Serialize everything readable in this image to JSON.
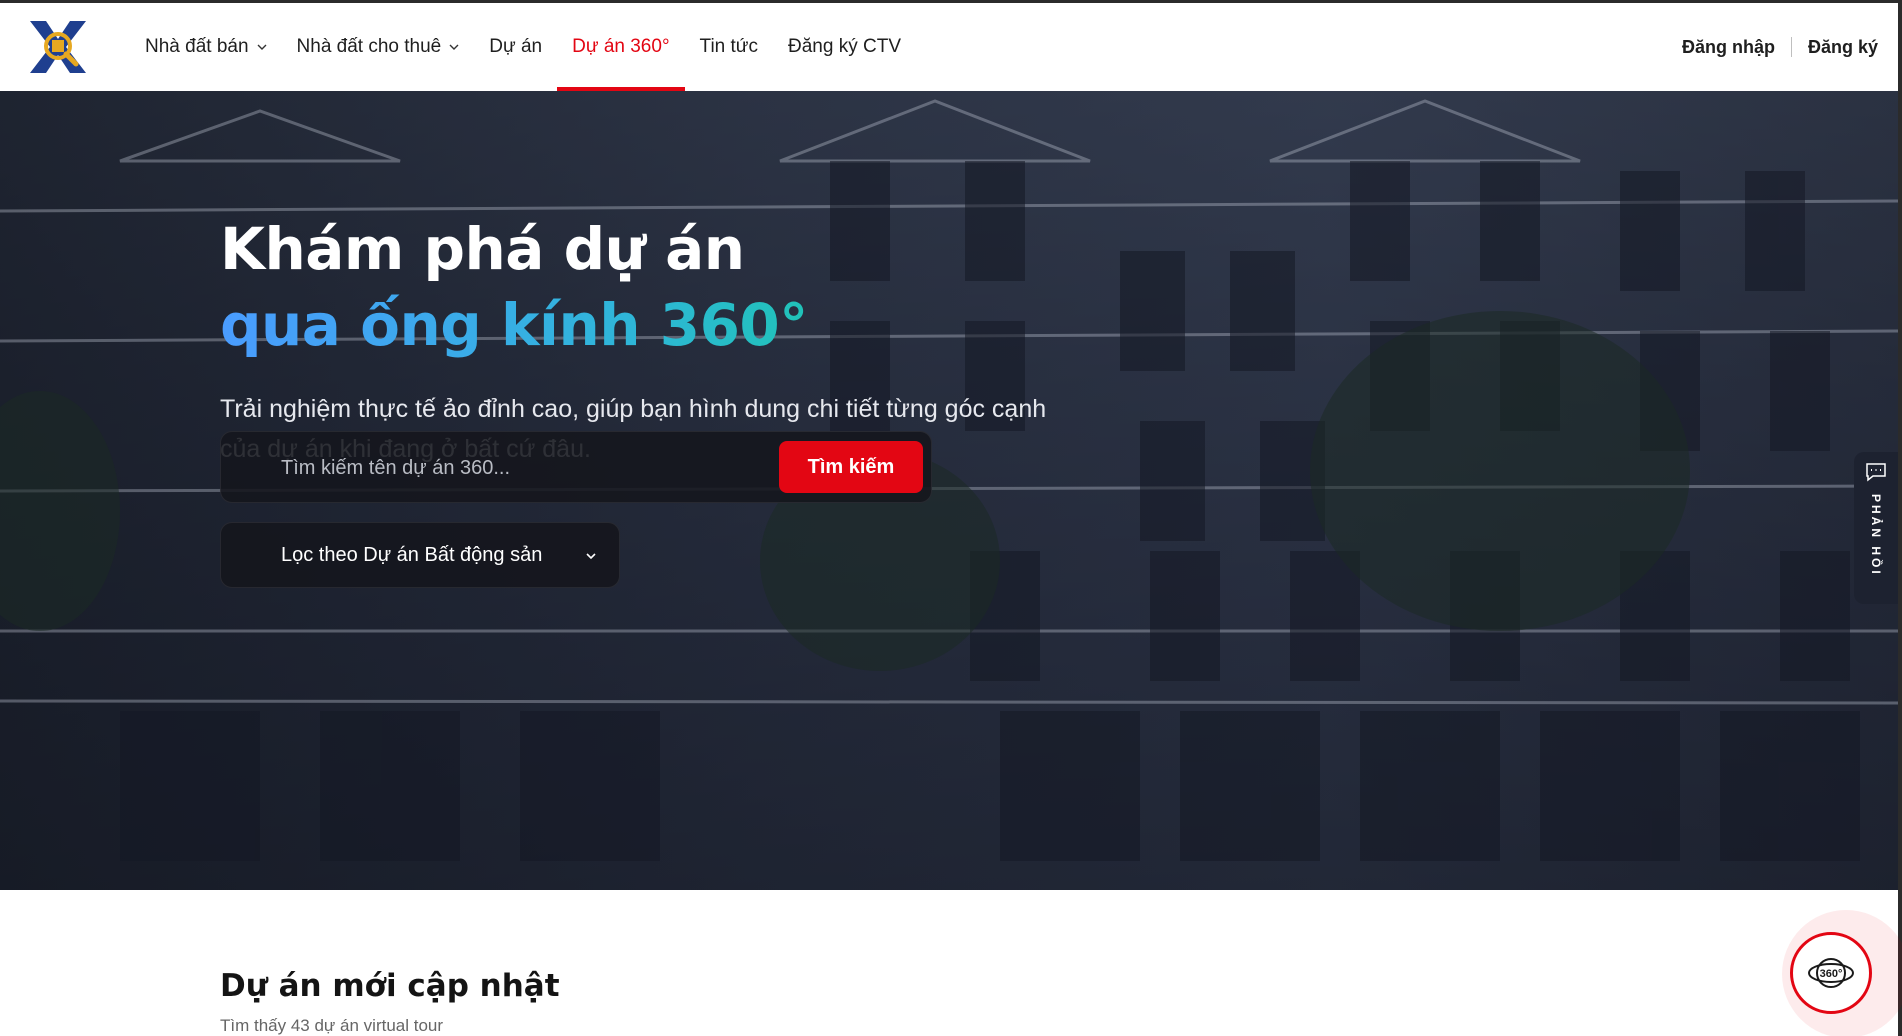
{
  "header": {
    "logo_alt": "logo",
    "nav": [
      {
        "label": "Nhà đất bán",
        "has_dropdown": true
      },
      {
        "label": "Nhà đất cho thuê",
        "has_dropdown": true
      },
      {
        "label": "Dự án",
        "has_dropdown": false
      },
      {
        "label": "Dự án 360°",
        "has_dropdown": false,
        "active": true
      },
      {
        "label": "Tin tức",
        "has_dropdown": false
      },
      {
        "label": "Đăng ký CTV",
        "has_dropdown": false
      }
    ],
    "login": "Đăng nhập",
    "register": "Đăng ký"
  },
  "hero": {
    "title_line1": "Khám phá dự án",
    "title_line2": "qua ống kính 360°",
    "subtitle": "Trải nghiệm thực tế ảo đỉnh cao, giúp bạn hình dung chi tiết từng góc cạnh của dự án khi đang ở bất cứ đâu.",
    "search_placeholder": "Tìm kiếm tên dự án 360...",
    "search_button": "Tìm kiếm",
    "filter_label": "Lọc theo Dự án Bất động sản"
  },
  "feedback": {
    "label": "PHẢN HỒI",
    "icon": "chat-icon"
  },
  "section": {
    "title": "Dự án mới cập nhật",
    "subtitle": "Tìm thấy 43 dự án virtual tour"
  },
  "fab": {
    "label": "360°",
    "icon": "globe-360-icon"
  },
  "colors": {
    "accent": "#e30613",
    "gradient_start": "#4a9cff",
    "gradient_end": "#16c99b"
  }
}
